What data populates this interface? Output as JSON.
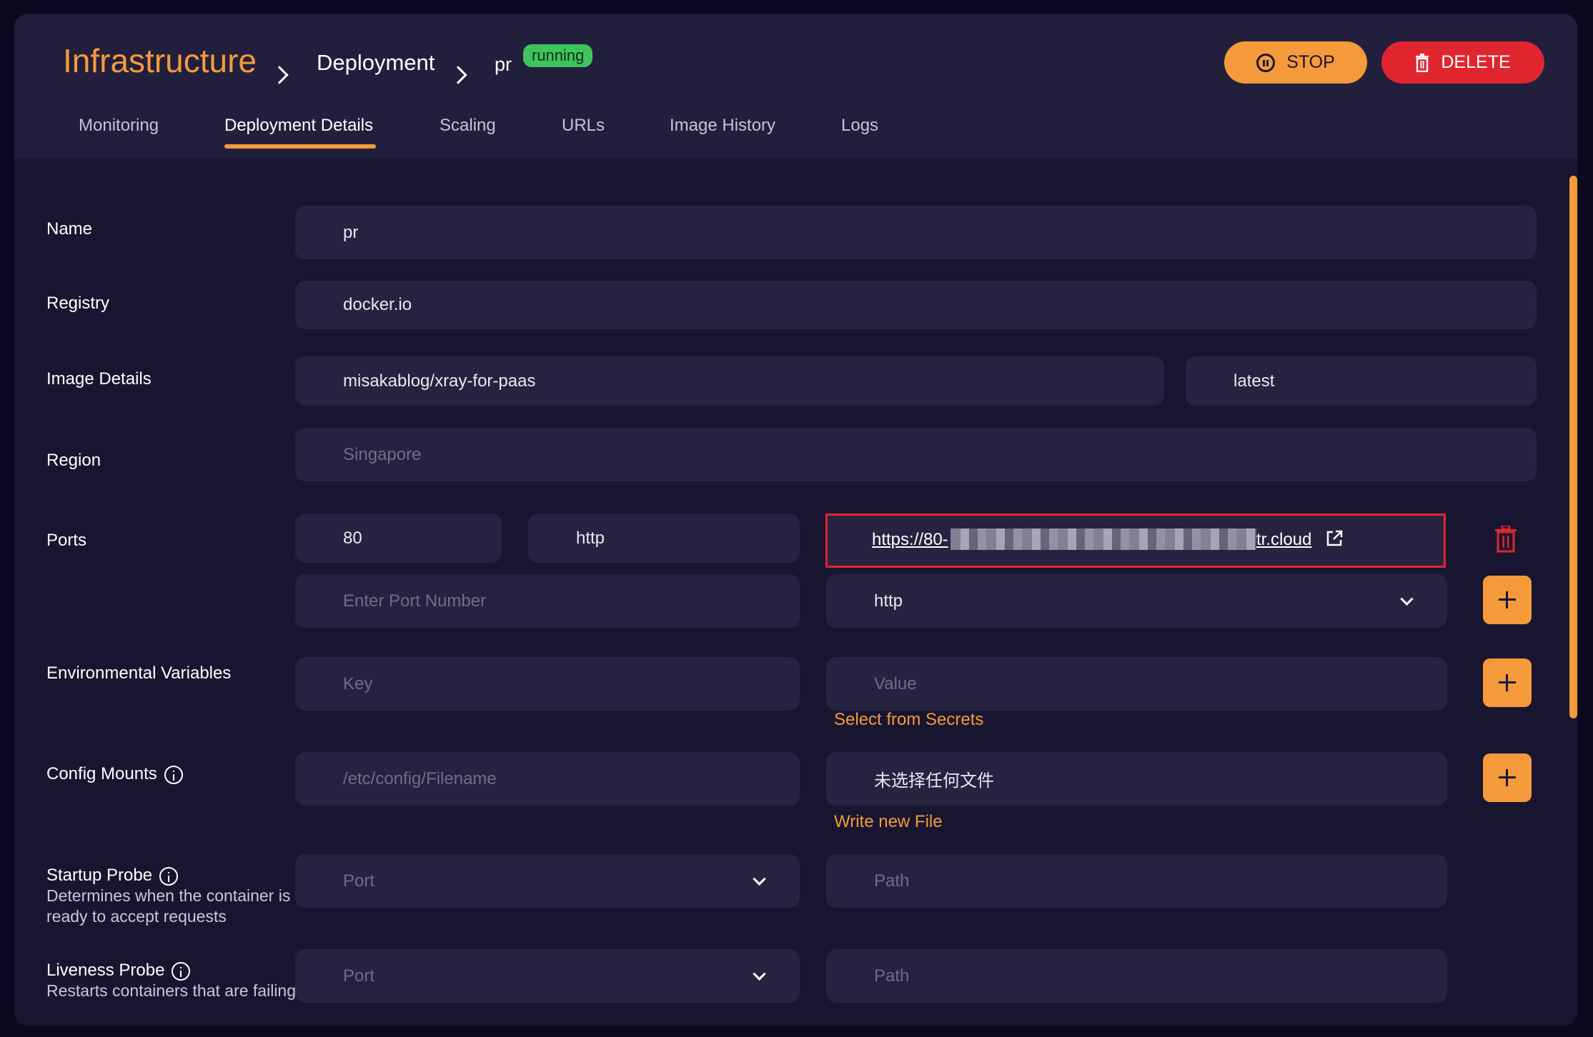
{
  "breadcrumb": {
    "root": "Infrastructure",
    "section": "Deployment",
    "current": "pr",
    "status": "running"
  },
  "actions": {
    "stop_label": "STOP",
    "delete_label": "DELETE"
  },
  "tabs": [
    {
      "label": "Monitoring"
    },
    {
      "label": "Deployment Details",
      "active": true
    },
    {
      "label": "Scaling"
    },
    {
      "label": "URLs"
    },
    {
      "label": "Image History"
    },
    {
      "label": "Logs"
    }
  ],
  "form": {
    "name": {
      "label": "Name",
      "value": "pr"
    },
    "registry": {
      "label": "Registry",
      "value": "docker.io"
    },
    "image": {
      "label": "Image Details",
      "repository": "misakablog/xray-for-paas",
      "tag": "latest"
    },
    "region": {
      "label": "Region",
      "placeholder": "Singapore"
    },
    "ports": {
      "label": "Ports",
      "existing": {
        "port": "80",
        "protocol": "http",
        "url_prefix": "https://80-",
        "url_suffix": "tr.cloud"
      },
      "new_port_placeholder": "Enter Port Number",
      "new_protocol": "http"
    },
    "env": {
      "label": "Environmental Variables",
      "key_placeholder": "Key",
      "value_placeholder": "Value",
      "secrets_link": "Select from Secrets"
    },
    "config": {
      "label": "Config Mounts",
      "path_placeholder": "/etc/config/Filename",
      "file_status": "未选择任何文件",
      "write_link": "Write new File"
    },
    "startup_probe": {
      "label": "Startup Probe",
      "description": "Determines when the container is ready to accept requests",
      "port_placeholder": "Port",
      "path_placeholder": "Path"
    },
    "liveness_probe": {
      "label": "Liveness Probe",
      "description": "Restarts containers that are failing",
      "port_placeholder": "Port",
      "path_placeholder": "Path"
    }
  },
  "colors": {
    "accent": "#f59a3a",
    "danger": "#e0252f",
    "success": "#3fc35e",
    "panel": "#181530",
    "field": "#262340"
  }
}
